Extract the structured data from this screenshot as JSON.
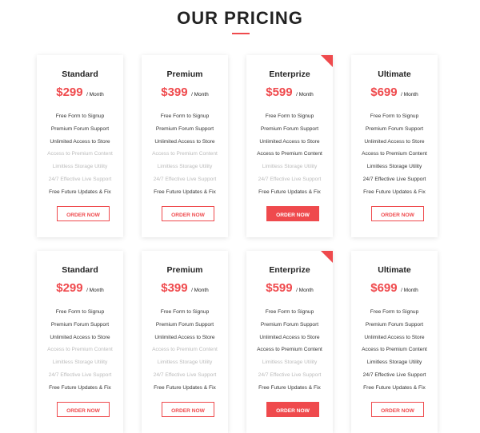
{
  "header": {
    "title": "OUR PRICING"
  },
  "plans": [
    {
      "name": "Standard",
      "price": "$299",
      "period": "/ Month",
      "features": [
        "Free Form to Signup",
        "Premium Forum Support",
        "Unlimited Access to Store",
        "Access to Premium Content",
        "Limitless Storage Utility",
        "24/7 Effective Live Support",
        "Free Future Updates & Fix"
      ],
      "features_enabled": [
        true,
        true,
        true,
        false,
        false,
        false,
        true
      ],
      "button": "ORDER NOW",
      "highlighted": false
    },
    {
      "name": "Premium",
      "price": "$399",
      "period": "/ Month",
      "features": [
        "Free Form to Signup",
        "Premium Forum Support",
        "Unlimited Access to Store",
        "Access to Premium Content",
        "Limitless Storage Utility",
        "24/7 Effective Live Support",
        "Free Future Updates & Fix"
      ],
      "features_enabled": [
        true,
        true,
        true,
        false,
        false,
        false,
        true
      ],
      "button": "ORDER NOW",
      "highlighted": false
    },
    {
      "name": "Enterprize",
      "price": "$599",
      "period": "/ Month",
      "features": [
        "Free Form to Signup",
        "Premium Forum Support",
        "Unlimited Access to Store",
        "Access to Premium Content",
        "Limitless Storage Utility",
        "24/7 Effective Live Support",
        "Free Future Updates & Fix"
      ],
      "features_enabled": [
        true,
        true,
        true,
        true,
        false,
        false,
        true
      ],
      "button": "ORDER NOW",
      "highlighted": true
    },
    {
      "name": "Ultimate",
      "price": "$699",
      "period": "/ Month",
      "features": [
        "Free Form to Signup",
        "Premium Forum Support",
        "Unlimited Access to Store",
        "Access to Premium Content",
        "Limitless Storage Utility",
        "24/7 Effective Live Support",
        "Free Future Updates & Fix"
      ],
      "features_enabled": [
        true,
        true,
        true,
        true,
        true,
        true,
        true
      ],
      "button": "ORDER NOW",
      "highlighted": false
    },
    {
      "name": "Standard",
      "price": "$299",
      "period": "/ Month",
      "features": [
        "Free Form to Signup",
        "Premium Forum Support",
        "Unlimited Access to Store",
        "Access to Premium Content",
        "Limitless Storage Utility",
        "24/7 Effective Live Support",
        "Free Future Updates & Fix"
      ],
      "features_enabled": [
        true,
        true,
        true,
        false,
        false,
        false,
        true
      ],
      "button": "ORDER NOW",
      "highlighted": false
    },
    {
      "name": "Premium",
      "price": "$399",
      "period": "/ Month",
      "features": [
        "Free Form to Signup",
        "Premium Forum Support",
        "Unlimited Access to Store",
        "Access to Premium Content",
        "Limitless Storage Utility",
        "24/7 Effective Live Support",
        "Free Future Updates & Fix"
      ],
      "features_enabled": [
        true,
        true,
        true,
        false,
        false,
        false,
        true
      ],
      "button": "ORDER NOW",
      "highlighted": false
    },
    {
      "name": "Enterprize",
      "price": "$599",
      "period": "/ Month",
      "features": [
        "Free Form to Signup",
        "Premium Forum Support",
        "Unlimited Access to Store",
        "Access to Premium Content",
        "Limitless Storage Utility",
        "24/7 Effective Live Support",
        "Free Future Updates & Fix"
      ],
      "features_enabled": [
        true,
        true,
        true,
        true,
        false,
        false,
        true
      ],
      "button": "ORDER NOW",
      "highlighted": true
    },
    {
      "name": "Ultimate",
      "price": "$699",
      "period": "/ Month",
      "features": [
        "Free Form to Signup",
        "Premium Forum Support",
        "Unlimited Access to Store",
        "Access to Premium Content",
        "Limitless Storage Utility",
        "24/7 Effective Live Support",
        "Free Future Updates & Fix"
      ],
      "features_enabled": [
        true,
        true,
        true,
        true,
        true,
        true,
        true
      ],
      "button": "ORDER NOW",
      "highlighted": false
    }
  ],
  "colors": {
    "accent": "#ef4a4d",
    "muted": "#bbbbbb",
    "text": "#222222"
  }
}
